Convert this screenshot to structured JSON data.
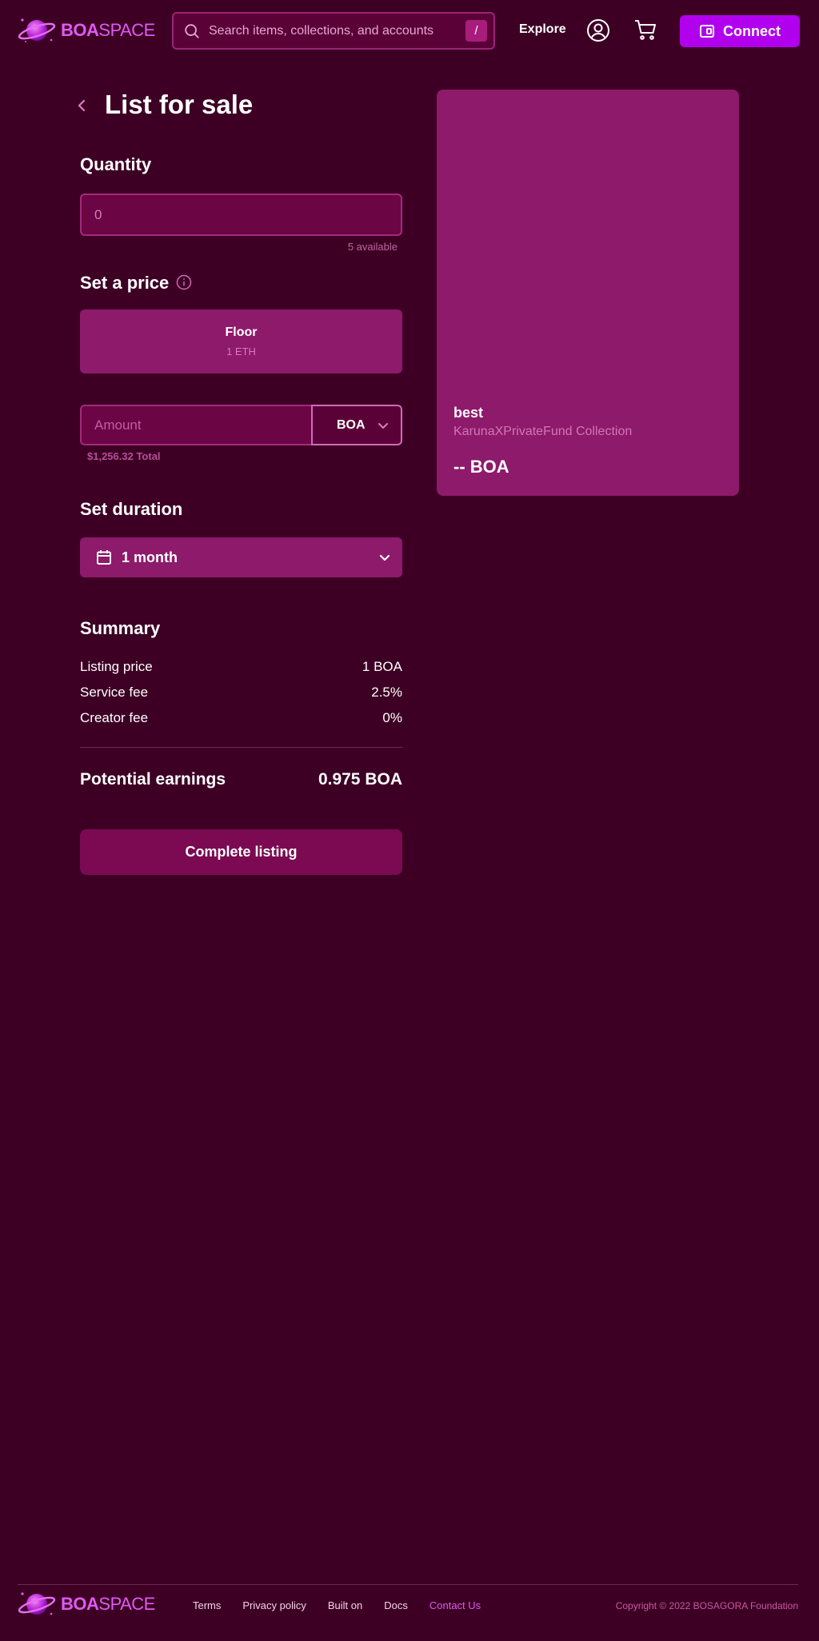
{
  "brand": {
    "bold": "BOA",
    "light": "SPACE"
  },
  "header": {
    "search_placeholder": "Search items, collections, and accounts",
    "search_shortcut": "/",
    "explore_label": "Explore",
    "connect_label": "Connect"
  },
  "page": {
    "title": "List for sale"
  },
  "quantity": {
    "title": "Quantity",
    "placeholder": "0",
    "available": "5 available"
  },
  "price": {
    "title": "Set a price",
    "floor_title": "Floor",
    "floor_value": "1 ETH",
    "amount_placeholder": "Amount",
    "currency": "BOA",
    "total": "$1,256.32 Total"
  },
  "duration": {
    "title": "Set duration",
    "value": "1 month"
  },
  "summary": {
    "title": "Summary",
    "rows": [
      {
        "label": "Listing price",
        "value": "1 BOA"
      },
      {
        "label": "Service fee",
        "value": "2.5%"
      },
      {
        "label": "Creator fee",
        "value": "0%"
      }
    ],
    "earnings_label": "Potential earnings",
    "earnings_value": "0.975 BOA",
    "complete_label": "Complete listing"
  },
  "preview": {
    "name": "best",
    "collection": "KarunaXPrivateFund Collection",
    "price": "-- BOA"
  },
  "footer": {
    "links": [
      "Terms",
      "Privacy policy",
      "Built on",
      "Docs",
      "Contact Us"
    ],
    "copyright": "Copyright © 2022 BOSAGORA Foundation"
  },
  "colors": {
    "background": "#3d0024",
    "accent": "#b100ee",
    "card": "#8e1a6b",
    "input": "#6b0543",
    "brand_pink": "#e059f2"
  },
  "icons": [
    "planet-logo-icon",
    "search-icon",
    "user-circle-icon",
    "cart-icon",
    "wallet-icon",
    "chevron-left-icon",
    "info-icon",
    "chevron-down-icon",
    "calendar-icon"
  ]
}
